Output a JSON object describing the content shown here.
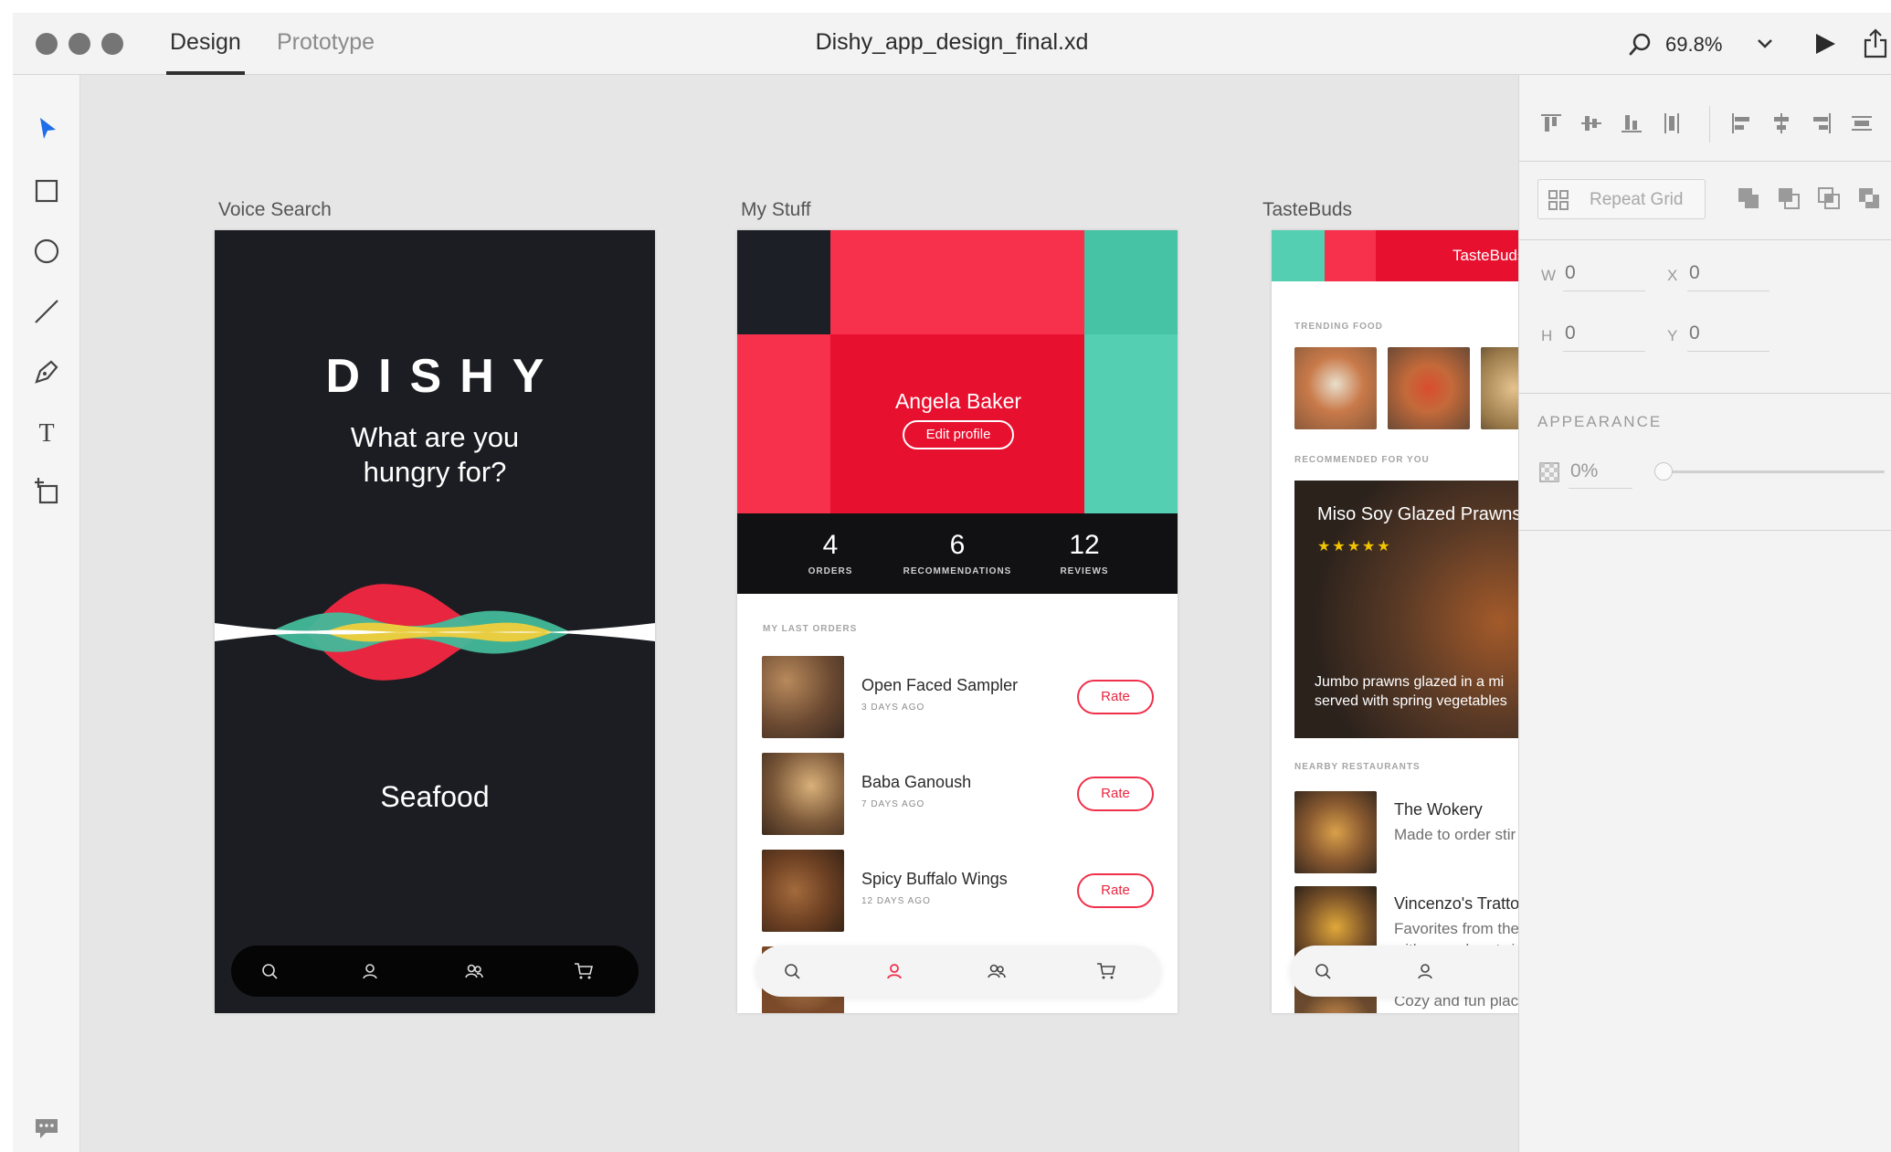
{
  "window": {
    "tabs": [
      {
        "label": "Design",
        "active": true
      },
      {
        "label": "Prototype",
        "active": false
      }
    ],
    "document_title": "Dishy_app_design_final.xd",
    "zoom": "69.8%"
  },
  "toolbar": {
    "tools": [
      "select-tool",
      "rectangle-tool",
      "ellipse-tool",
      "line-tool",
      "pen-tool",
      "text-tool",
      "artboard-tool"
    ],
    "bottom": "feedback-icon"
  },
  "panel": {
    "repeat_grid_label": "Repeat Grid",
    "w_label": "W",
    "w_value": "0",
    "x_label": "X",
    "x_value": "0",
    "h_label": "H",
    "h_value": "0",
    "y_label": "Y",
    "y_value": "0",
    "appearance_label": "APPEARANCE",
    "opacity_value": "0%",
    "opacity_fraction": 0.0
  },
  "artboards": {
    "voice": {
      "label": "Voice Search",
      "logo": "DISHY",
      "question_line1": "What are you",
      "question_line2": "hungry for?",
      "spoken_word": "Seafood"
    },
    "mystuff": {
      "label": "My Stuff",
      "profile_name": "Angela Baker",
      "edit_profile": "Edit profile",
      "stats": [
        {
          "value": "4",
          "label": "ORDERS"
        },
        {
          "value": "6",
          "label": "RECOMMENDATIONS"
        },
        {
          "value": "12",
          "label": "REVIEWS"
        }
      ],
      "last_orders_heading": "MY LAST ORDERS",
      "orders": [
        {
          "name": "Open Faced Sampler",
          "date": "3 DAYS AGO",
          "action": "Rate"
        },
        {
          "name": "Baba Ganoush",
          "date": "7 DAYS AGO",
          "action": "Rate"
        },
        {
          "name": "Spicy Buffalo Wings",
          "date": "12 DAYS AGO",
          "action": "Rate"
        }
      ]
    },
    "tastebuds": {
      "label": "TasteBuds",
      "header_title": "TasteBuds",
      "trending_heading": "TRENDING FOOD",
      "recommended_heading": "RECOMMENDED FOR YOU",
      "recommended": {
        "title": "Miso Soy Glazed Prawns",
        "stars": "★★★★★",
        "desc_line1": "Jumbo prawns glazed in a mi",
        "desc_line2": "served with spring vegetables"
      },
      "nearby_heading": "NEARBY RESTAURANTS",
      "restaurants": [
        {
          "name": "The Wokery",
          "desc_line1": "Made to order stir",
          "desc_line2": ""
        },
        {
          "name": "Vincenzo's Trattori",
          "desc_line1": "Favorites from the",
          "desc_line2": "with a modern twis"
        },
        {
          "name": "",
          "desc_line1": "Cozy and fun plac",
          "desc_line2": ""
        }
      ]
    }
  },
  "colors": {
    "brand_red": "#f0304a",
    "brand_teal": "#4fcbab",
    "dark": "#1c1d22"
  }
}
